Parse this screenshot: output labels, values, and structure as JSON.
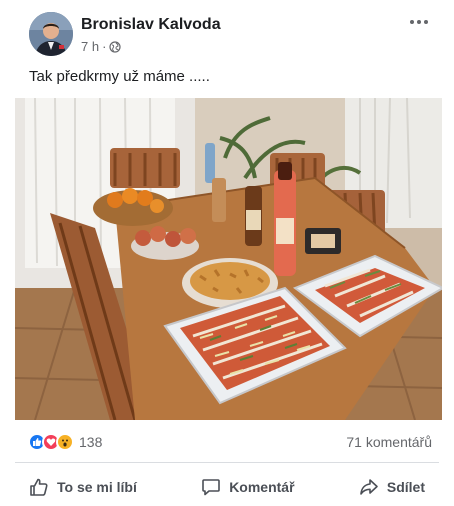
{
  "post": {
    "author": "Bronislav Kalvoda",
    "time": "7 h",
    "separator": "·",
    "privacy_icon": "globe-icon",
    "text": "Tak předkrmy už máme .....",
    "reaction_icons": [
      "like-icon",
      "love-icon",
      "wow-icon"
    ],
    "reaction_count": "138",
    "comments": "71 komentářů",
    "actions": {
      "like": "To se mi líbí",
      "comment": "Komentář",
      "share": "Sdílet"
    }
  },
  "colors": {
    "like": "#1877f2",
    "love": "#f33e58",
    "wow": "#f7b125",
    "secondary_text": "#65676b"
  }
}
